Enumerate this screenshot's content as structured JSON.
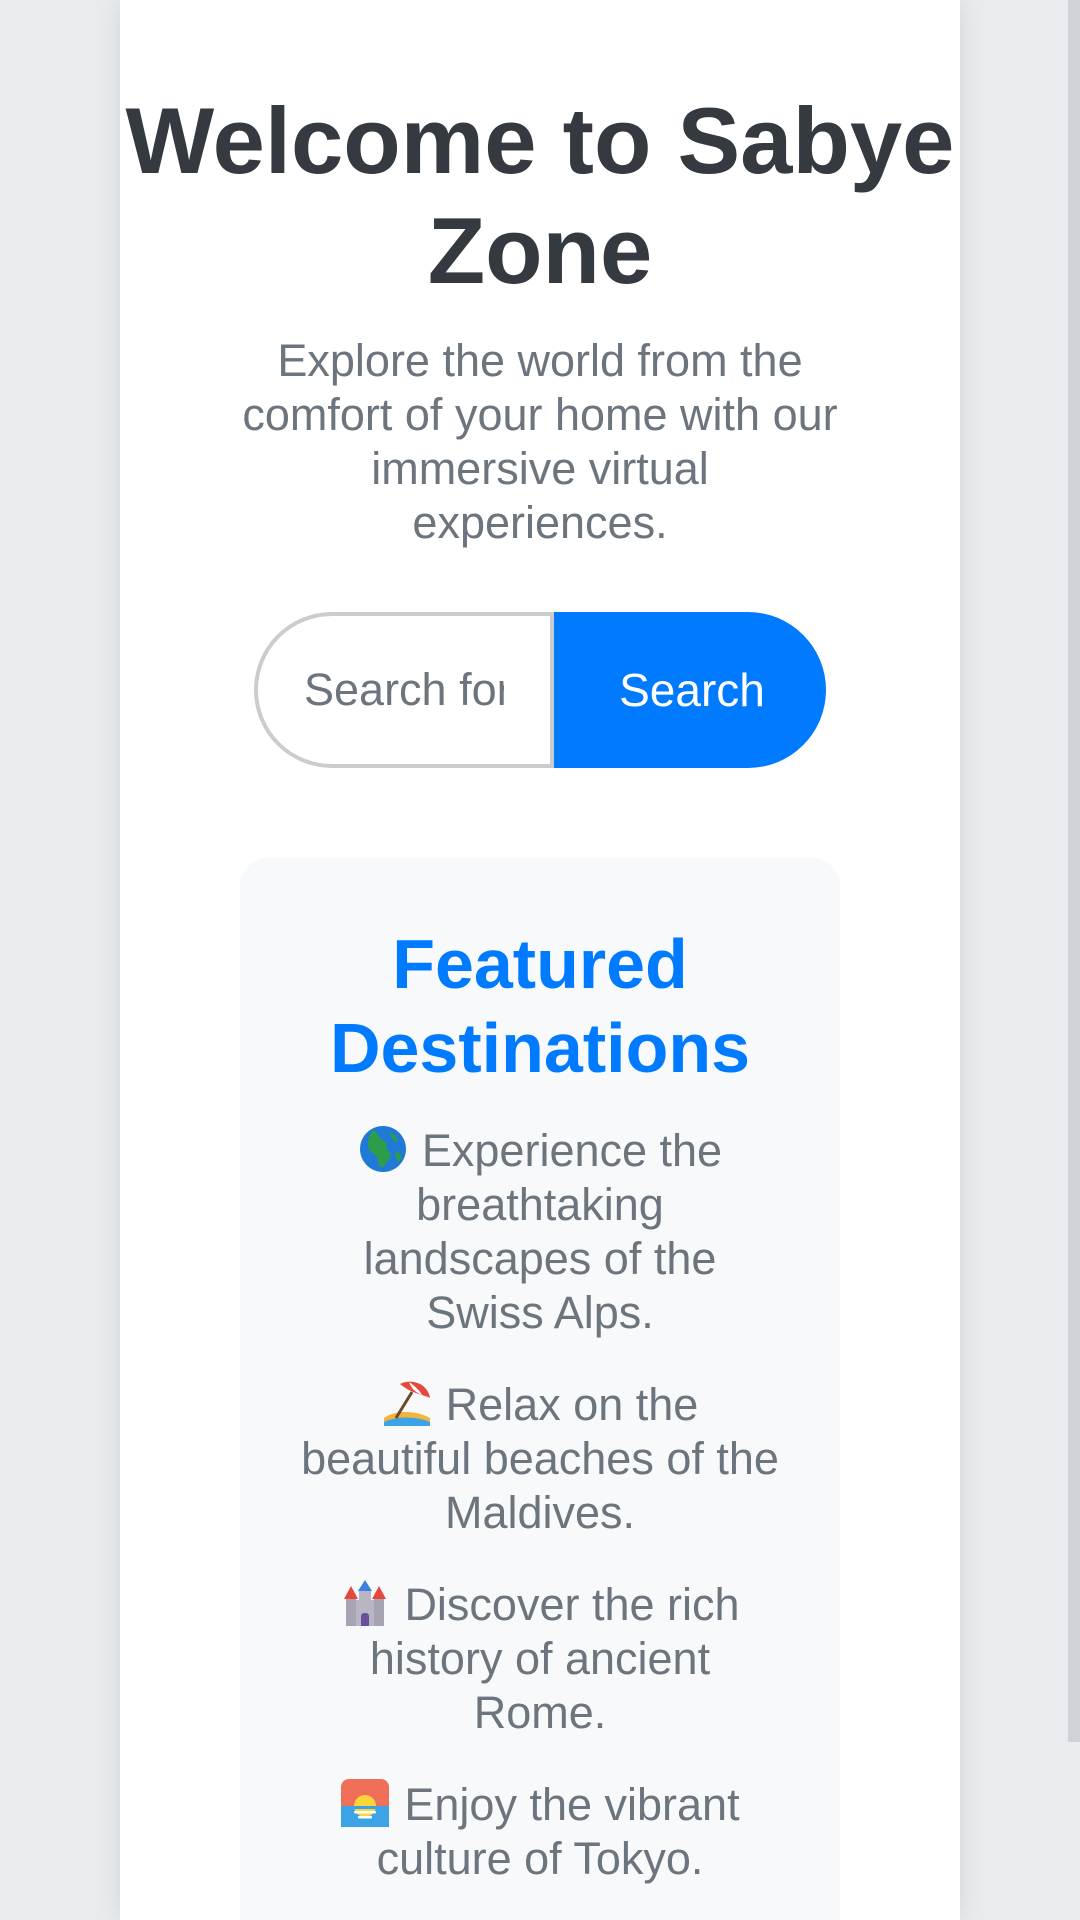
{
  "hero": {
    "title": "Welcome to Sabye Zone",
    "subtitle": "Explore the world from the comfort of your home with our immersive virtual experiences."
  },
  "search": {
    "placeholder": "Search for destinations...",
    "button_label": "Search"
  },
  "featured": {
    "title": "Featured Destinations",
    "items": [
      {
        "icon": "globe-europe-africa-icon",
        "text": "Experience the breathtaking landscapes of the Swiss Alps."
      },
      {
        "icon": "beach-umbrella-icon",
        "text": "Relax on the beautiful beaches of the Maldives."
      },
      {
        "icon": "castle-icon",
        "text": "Discover the rich history of ancient Rome."
      },
      {
        "icon": "sunrise-icon",
        "text": "Enjoy the vibrant culture of Tokyo."
      }
    ]
  },
  "colors": {
    "accent": "#007bff",
    "heading": "#343a40",
    "muted_text": "#6c757d",
    "panel_bg": "#f8f9fa",
    "page_bg": "#e9ecef"
  }
}
